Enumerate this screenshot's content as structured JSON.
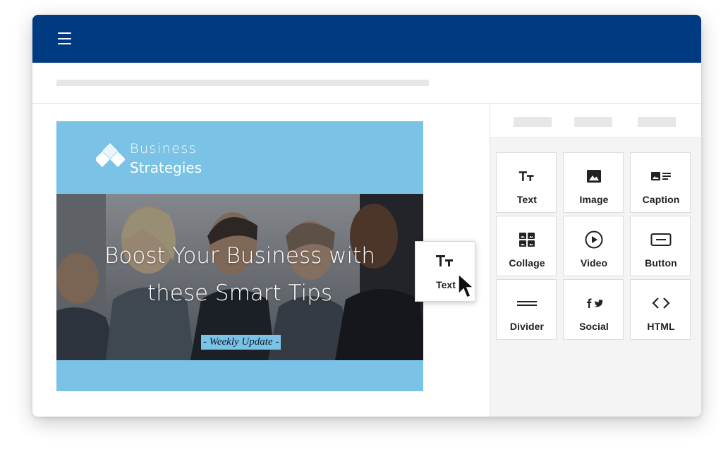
{
  "canvas": {
    "brand": {
      "line1": "Business",
      "line2": "Strategies"
    },
    "hero": {
      "title_line1": "Boost Your Business with",
      "title_line2": "these Smart Tips",
      "badge": "- Weekly Update -"
    }
  },
  "drag_tile": {
    "label": "Text",
    "icon": "text-format-icon"
  },
  "panel": {
    "blocks": [
      {
        "label": "Text",
        "icon": "text-format-icon"
      },
      {
        "label": "Image",
        "icon": "image-icon"
      },
      {
        "label": "Caption",
        "icon": "caption-icon"
      },
      {
        "label": "Collage",
        "icon": "collage-icon"
      },
      {
        "label": "Video",
        "icon": "play-circle-icon"
      },
      {
        "label": "Button",
        "icon": "button-icon"
      },
      {
        "label": "Divider",
        "icon": "divider-icon"
      },
      {
        "label": "Social",
        "icon": "social-icon"
      },
      {
        "label": "HTML",
        "icon": "code-icon"
      }
    ]
  },
  "colors": {
    "topbar": "#003a80",
    "canvas_bg": "#7ac3e6",
    "panel_bg": "#f4f4f4"
  }
}
